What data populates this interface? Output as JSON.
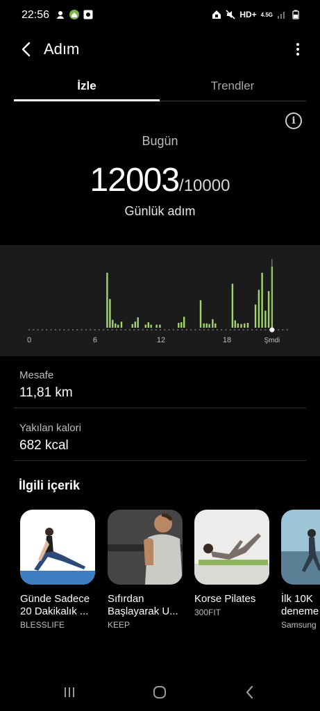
{
  "status_bar": {
    "time": "22:56",
    "network": "HD+",
    "signal_label": "4.5G"
  },
  "header": {
    "title": "Adım"
  },
  "tabs": [
    {
      "label": "İzle",
      "active": true
    },
    {
      "label": "Trendler",
      "active": false
    }
  ],
  "summary": {
    "day_label": "Bugün",
    "steps": "12003",
    "goal": "/10000",
    "caption": "Günlük adım"
  },
  "chart_data": {
    "type": "bar",
    "x_tick_labels": [
      "0",
      "6",
      "12",
      "18",
      "Şmdi"
    ],
    "x_range_hours": [
      0,
      23.75
    ],
    "bars": [
      {
        "h": 7.1,
        "v": 0.9,
        "c": "#9fd76a"
      },
      {
        "h": 7.35,
        "v": 0.47,
        "c": "#9fd76a"
      },
      {
        "h": 7.6,
        "v": 0.13,
        "c": "#9fd76a"
      },
      {
        "h": 7.85,
        "v": 0.07,
        "c": "#9fd76a"
      },
      {
        "h": 8.1,
        "v": 0.05,
        "c": "#9fd76a"
      },
      {
        "h": 8.4,
        "v": 0.1,
        "c": "#9fd76a"
      },
      {
        "h": 9.4,
        "v": 0.06,
        "c": "#9fd76a"
      },
      {
        "h": 9.65,
        "v": 0.1,
        "c": "#9fd76a"
      },
      {
        "h": 9.9,
        "v": 0.17,
        "c": "#9fd76a"
      },
      {
        "h": 10.6,
        "v": 0.05,
        "c": "#9fd76a"
      },
      {
        "h": 10.85,
        "v": 0.09,
        "c": "#9fd76a"
      },
      {
        "h": 11.1,
        "v": 0.05,
        "c": "#9fd76a"
      },
      {
        "h": 11.6,
        "v": 0.05,
        "c": "#9fd76a"
      },
      {
        "h": 11.9,
        "v": 0.05,
        "c": "#9fd76a"
      },
      {
        "h": 13.6,
        "v": 0.08,
        "c": "#9fd76a"
      },
      {
        "h": 13.85,
        "v": 0.09,
        "c": "#9fd76a"
      },
      {
        "h": 14.1,
        "v": 0.18,
        "c": "#9fd76a"
      },
      {
        "h": 15.6,
        "v": 0.45,
        "c": "#9fd76a"
      },
      {
        "h": 15.9,
        "v": 0.07,
        "c": "#9fd76a"
      },
      {
        "h": 16.15,
        "v": 0.07,
        "c": "#9fd76a"
      },
      {
        "h": 16.4,
        "v": 0.06,
        "c": "#9fd76a"
      },
      {
        "h": 16.7,
        "v": 0.14,
        "c": "#9fd76a"
      },
      {
        "h": 16.95,
        "v": 0.07,
        "c": "#9fd76a"
      },
      {
        "h": 18.5,
        "v": 0.72,
        "c": "#9fd76a"
      },
      {
        "h": 18.75,
        "v": 0.12,
        "c": "#9fd76a"
      },
      {
        "h": 19.0,
        "v": 0.07,
        "c": "#9fd76a"
      },
      {
        "h": 19.3,
        "v": 0.06,
        "c": "#9fd76a"
      },
      {
        "h": 19.6,
        "v": 0.07,
        "c": "#9fd76a"
      },
      {
        "h": 19.9,
        "v": 0.08,
        "c": "#9fd76a"
      },
      {
        "h": 20.6,
        "v": 0.38,
        "c": "#9fd76a"
      },
      {
        "h": 20.9,
        "v": 0.62,
        "c": "#9fd76a"
      },
      {
        "h": 21.2,
        "v": 0.9,
        "c": "#9fd76a"
      },
      {
        "h": 21.5,
        "v": 0.28,
        "c": "#9fd76a"
      },
      {
        "h": 21.8,
        "v": 0.6,
        "c": "#9fd76a"
      },
      {
        "h": 22.1,
        "v": 1.0,
        "c": "#9fd76a"
      }
    ]
  },
  "stats": {
    "distance_label": "Mesafe",
    "distance_value": "11,81 km",
    "calorie_label": "Yakılan kalori",
    "calorie_value": "682 kcal"
  },
  "related": {
    "title": "İlgili içerik",
    "items": [
      {
        "title": "Günde Sadece",
        "title2": "20 Dakikalık ...",
        "source": "BLESSLIFE",
        "image": "stretching-woman"
      },
      {
        "title": "Sıfırdan",
        "title2": "Başlayarak U...",
        "source": "KEEP",
        "image": "gym-man"
      },
      {
        "title": "Korse Pilates",
        "title2": "",
        "source": "300FIT",
        "image": "pilates-woman"
      },
      {
        "title": "İlk 10K",
        "title2": "deneme",
        "source": "Samsung",
        "image": "runner-beach"
      }
    ]
  },
  "colors": {
    "accent_green": "#9fd76a",
    "background": "#000000",
    "panel": "#1b1b1b"
  }
}
